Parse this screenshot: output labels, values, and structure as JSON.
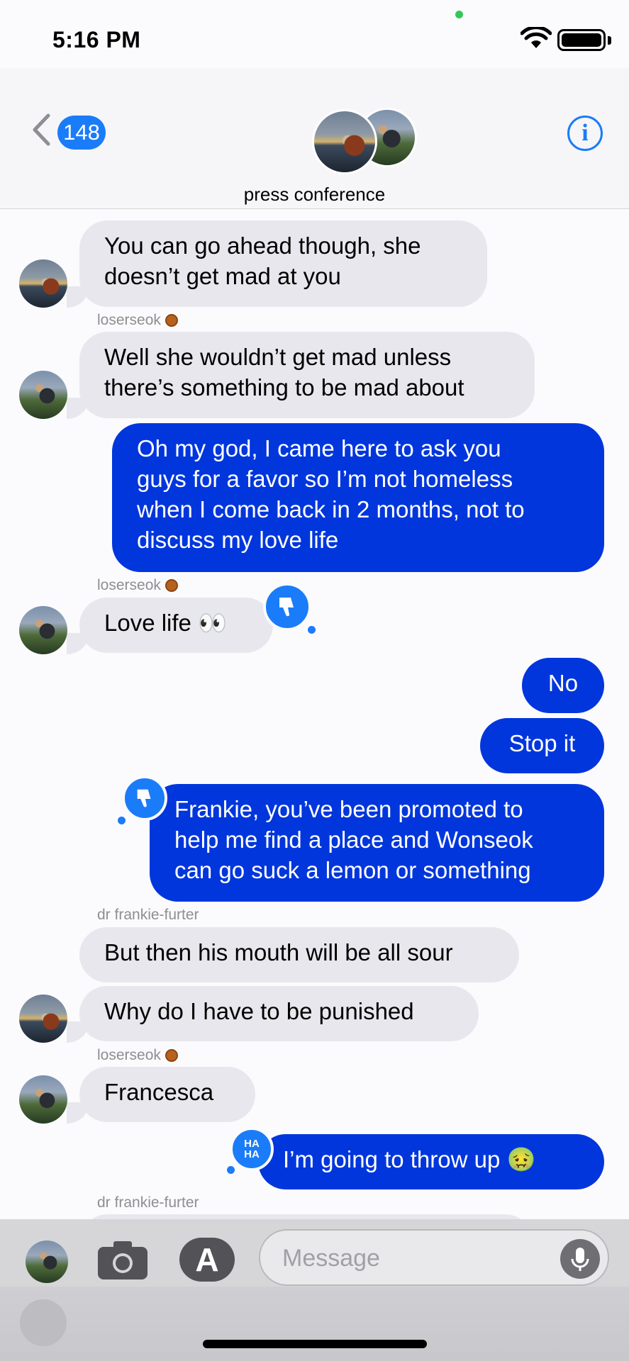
{
  "status_bar": {
    "time": "5:16 PM"
  },
  "header": {
    "back_count": "148",
    "group_name": "press conference",
    "info_label": "i"
  },
  "colors": {
    "sent_bubble": "#0036dc",
    "received_bubble": "#e8e7ed",
    "accent": "#1a7cf8"
  },
  "messages": [
    {
      "from": "other",
      "text": "You can go ahead though, she\ndoesn’t get mad at you"
    },
    {
      "from": "other",
      "sender": "loserseok",
      "text": "Well she wouldn’t get mad unless\nthere’s something to be mad about"
    },
    {
      "from": "me",
      "text": "Oh my god, I came here to ask you\nguys for a favor so I’m not homeless\nwhen I come back in 2 months, not to\ndiscuss my love life"
    },
    {
      "from": "other",
      "sender": "loserseok",
      "text": "Love life 👀",
      "tapback": "thumbs-down"
    },
    {
      "from": "me",
      "text": "No"
    },
    {
      "from": "me",
      "text": "Stop it"
    },
    {
      "from": "me",
      "text": "Frankie, you’ve been promoted to\nhelp me find a place and Wonseok\ncan go suck a lemon or something",
      "tapback": "thumbs-down"
    },
    {
      "from": "other",
      "sender": "dr frankie-furter",
      "text": "But then his mouth will be all sour"
    },
    {
      "from": "other",
      "text": "Why do I have to be punished"
    },
    {
      "from": "other",
      "sender": "loserseok",
      "text": "Francesca"
    },
    {
      "from": "me",
      "text": "I’m going to throw up 🤢",
      "tapback": "haha",
      "tapback_label": "HA\nHA"
    },
    {
      "from": "other",
      "sender": "dr frankie-furter",
      "text": ""
    }
  ],
  "input": {
    "placeholder": "Message"
  },
  "icons": [
    "wifi-icon",
    "battery-icon",
    "back-chevron-icon",
    "info-icon",
    "camera-icon",
    "app-store-icon",
    "microphone-icon",
    "thumbs-down-icon"
  ]
}
